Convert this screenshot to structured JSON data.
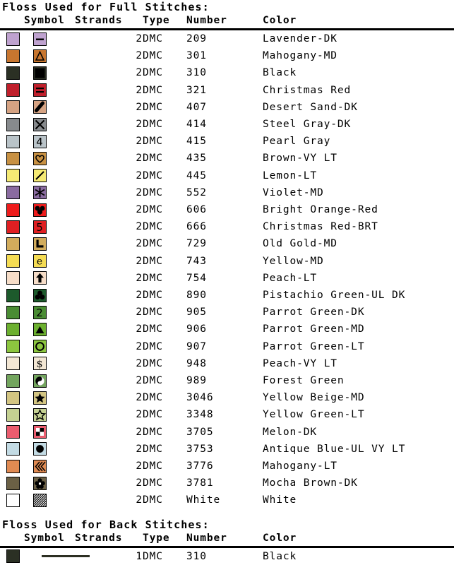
{
  "full_section": {
    "title": "Floss Used for Full Stitches:",
    "columns": [
      "Symbol",
      "Strands",
      "Type",
      "Number",
      "Color"
    ],
    "rows": [
      {
        "swatch": "#bfa2cf",
        "sym_bg": "#bfa2cf",
        "icon": "dash-icon",
        "strands": "2",
        "type": "DMC",
        "number": "209",
        "color": "Lavender-DK"
      },
      {
        "swatch": "#c8762f",
        "sym_bg": "#c8762f",
        "icon": "triangle-outline-icon",
        "strands": "2",
        "type": "DMC",
        "number": "301",
        "color": "Mahogany-MD"
      },
      {
        "swatch": "#2b3024",
        "sym_bg": "#2b3024",
        "icon": "filled-square-icon",
        "strands": "2",
        "type": "DMC",
        "number": "310",
        "color": "Black"
      },
      {
        "swatch": "#c01f2b",
        "sym_bg": "#c01f2b",
        "icon": "equals-icon",
        "strands": "2",
        "type": "DMC",
        "number": "321",
        "color": "Christmas Red"
      },
      {
        "swatch": "#d6a383",
        "sym_bg": "#d6a383",
        "icon": "diagonal-bar-icon",
        "strands": "2",
        "type": "DMC",
        "number": "407",
        "color": "Desert Sand-DK"
      },
      {
        "swatch": "#878a8d",
        "sym_bg": "#878a8d",
        "icon": "x-cross-icon",
        "strands": "2",
        "type": "DMC",
        "number": "414",
        "color": "Steel Gray-DK"
      },
      {
        "swatch": "#b9c3c8",
        "sym_bg": "#b9c3c8",
        "icon": "digit-four-icon",
        "strands": "2",
        "type": "DMC",
        "number": "415",
        "color": "Pearl Gray"
      },
      {
        "swatch": "#c89143",
        "sym_bg": "#c89143",
        "icon": "heart-outline-icon",
        "strands": "2",
        "type": "DMC",
        "number": "435",
        "color": "Brown-VY LT"
      },
      {
        "swatch": "#f5ea74",
        "sym_bg": "#f5ea74",
        "icon": "slash-icon",
        "strands": "2",
        "type": "DMC",
        "number": "445",
        "color": "Lemon-LT"
      },
      {
        "swatch": "#8a6ba0",
        "sym_bg": "#8a6ba0",
        "icon": "asterisk-icon",
        "strands": "2",
        "type": "DMC",
        "number": "552",
        "color": "Violet-MD"
      },
      {
        "swatch": "#ee1c1c",
        "sym_bg": "#ee1c1c",
        "icon": "clover-dark-icon",
        "strands": "2",
        "type": "DMC",
        "number": "606",
        "color": "Bright Orange-Red"
      },
      {
        "swatch": "#e01f22",
        "sym_bg": "#e01f22",
        "icon": "digit-five-icon",
        "strands": "2",
        "type": "DMC",
        "number": "666",
        "color": "Christmas Red-BRT"
      },
      {
        "swatch": "#d2ac5c",
        "sym_bg": "#d2ac5c",
        "icon": "letter-l-icon",
        "strands": "2",
        "type": "DMC",
        "number": "729",
        "color": "Old Gold-MD"
      },
      {
        "swatch": "#f5dc53",
        "sym_bg": "#f5dc53",
        "icon": "letter-e-icon",
        "strands": "2",
        "type": "DMC",
        "number": "743",
        "color": "Yellow-MD"
      },
      {
        "swatch": "#f6ddc8",
        "sym_bg": "#f6ddc8",
        "icon": "up-arrow-icon",
        "strands": "2",
        "type": "DMC",
        "number": "754",
        "color": "Peach-LT"
      },
      {
        "swatch": "#1d5a2c",
        "sym_bg": "#1d5a2c",
        "icon": "trefoil-icon",
        "strands": "2",
        "type": "DMC",
        "number": "890",
        "color": "Pistachio Green-UL DK"
      },
      {
        "swatch": "#4a8c33",
        "sym_bg": "#4a8c33",
        "icon": "digit-two-icon",
        "strands": "2",
        "type": "DMC",
        "number": "905",
        "color": "Parrot Green-DK"
      },
      {
        "swatch": "#6cb02f",
        "sym_bg": "#6cb02f",
        "icon": "filled-triangle-icon",
        "strands": "2",
        "type": "DMC",
        "number": "906",
        "color": "Parrot Green-MD"
      },
      {
        "swatch": "#8cc63f",
        "sym_bg": "#8cc63f",
        "icon": "circle-outline-icon",
        "strands": "2",
        "type": "DMC",
        "number": "907",
        "color": "Parrot Green-LT"
      },
      {
        "swatch": "#f3e7d4",
        "sym_bg": "#f3e7d4",
        "icon": "dollar-sign-icon",
        "strands": "2",
        "type": "DMC",
        "number": "948",
        "color": "Peach-VY LT"
      },
      {
        "swatch": "#73a55e",
        "sym_bg": "#73a55e",
        "icon": "yin-yang-icon",
        "strands": "2",
        "type": "DMC",
        "number": "989",
        "color": "Forest Green"
      },
      {
        "swatch": "#d3c582",
        "sym_bg": "#d3c582",
        "icon": "filled-star-icon",
        "strands": "2",
        "type": "DMC",
        "number": "3046",
        "color": "Yellow Beige-MD"
      },
      {
        "swatch": "#c5d192",
        "sym_bg": "#c5d192",
        "icon": "star-outline-icon",
        "strands": "2",
        "type": "DMC",
        "number": "3348",
        "color": "Yellow Green-LT"
      },
      {
        "swatch": "#ea5c6e",
        "sym_bg": "#ea5c6e",
        "icon": "checker-square-icon",
        "strands": "2",
        "type": "DMC",
        "number": "3705",
        "color": "Melon-DK"
      },
      {
        "swatch": "#c3dbe4",
        "sym_bg": "#c3dbe4",
        "icon": "filled-circle-icon",
        "strands": "2",
        "type": "DMC",
        "number": "3753",
        "color": "Antique Blue-UL VY LT"
      },
      {
        "swatch": "#e08a52",
        "sym_bg": "#e08a52",
        "icon": "chevrons-left-icon",
        "strands": "2",
        "type": "DMC",
        "number": "3776",
        "color": "Mahogany-LT"
      },
      {
        "swatch": "#6b6045",
        "sym_bg": "#6b6045",
        "icon": "flower-icon",
        "strands": "2",
        "type": "DMC",
        "number": "3781",
        "color": "Mocha Brown-DK"
      },
      {
        "swatch": "#ffffff",
        "sym_bg": "#ffffff",
        "icon": "hatch-fill-icon",
        "strands": "2",
        "type": "DMC",
        "number": "White",
        "color": "White"
      }
    ]
  },
  "back_section": {
    "title": "Floss Used for Back Stitches:",
    "columns": [
      "Symbol",
      "Strands",
      "Type",
      "Number",
      "Color"
    ],
    "rows": [
      {
        "swatch": "#2b3024",
        "icon": "solid-line-icon",
        "strands": "1",
        "type": "DMC",
        "number": "310",
        "color": "Black"
      }
    ]
  }
}
